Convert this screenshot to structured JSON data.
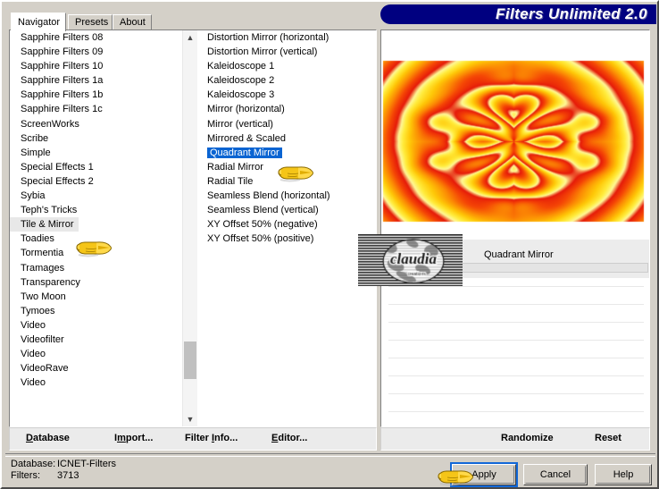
{
  "window": {
    "title": "Filters Unlimited 2.0",
    "title_bg": "#000080"
  },
  "tabs": [
    {
      "label": "Navigator",
      "active": true
    },
    {
      "label": "Presets",
      "active": false
    },
    {
      "label": "About",
      "active": false
    }
  ],
  "categories": {
    "selected": "Tile & Mirror",
    "items": [
      "Sapphire Filters 08",
      "Sapphire Filters 09",
      "Sapphire Filters 10",
      "Sapphire Filters 1a",
      "Sapphire Filters 1b",
      "Sapphire Filters 1c",
      "ScreenWorks",
      "Scribe",
      "Simple",
      "Special Effects 1",
      "Special Effects 2",
      "Sybia",
      "Teph's Tricks",
      "Tile & Mirror",
      "Toadies",
      "Tormentia",
      "Tramages",
      "Transparency",
      "Two Moon",
      "Tymoes",
      "Video",
      "Videofilter",
      "Video",
      "VideoRave",
      "Video"
    ]
  },
  "filters": {
    "selected": "Quadrant Mirror",
    "items": [
      "Distortion Mirror (horizontal)",
      "Distortion Mirror (vertical)",
      "Kaleidoscope 1",
      "Kaleidoscope 2",
      "Kaleidoscope 3",
      "Mirror (horizontal)",
      "Mirror (vertical)",
      "Mirrored & Scaled",
      "Quadrant Mirror",
      "Radial Mirror",
      "Radial Tile",
      "Seamless Blend (horizontal)",
      "Seamless Blend (vertical)",
      "XY Offset 50% (negative)",
      "XY Offset 50% (positive)"
    ]
  },
  "links": [
    {
      "label": "Database",
      "accel": "D"
    },
    {
      "label": "Import...",
      "accel": "m"
    },
    {
      "label": "Filter Info...",
      "accel": "I"
    },
    {
      "label": "Editor...",
      "accel": "E"
    }
  ],
  "parameters": {
    "title": "Quadrant Mirror",
    "thumbnail_label": "claudia"
  },
  "right_actions": [
    {
      "label": "Randomize"
    },
    {
      "label": "Reset"
    }
  ],
  "status": {
    "database_label": "Database:",
    "database_value": "ICNET-Filters",
    "filters_label": "Filters:",
    "filters_value": "3713"
  },
  "dialog_buttons": [
    {
      "label": "Apply",
      "focused": true
    },
    {
      "label": "Cancel",
      "focused": false
    },
    {
      "label": "Help",
      "focused": false
    }
  ],
  "cursors": [
    {
      "name": "hand-cursor-category",
      "points_at": "Tile & Mirror"
    },
    {
      "name": "hand-cursor-filter",
      "points_at": "Quadrant Mirror"
    },
    {
      "name": "hand-cursor-apply",
      "points_at": "Apply"
    }
  ]
}
